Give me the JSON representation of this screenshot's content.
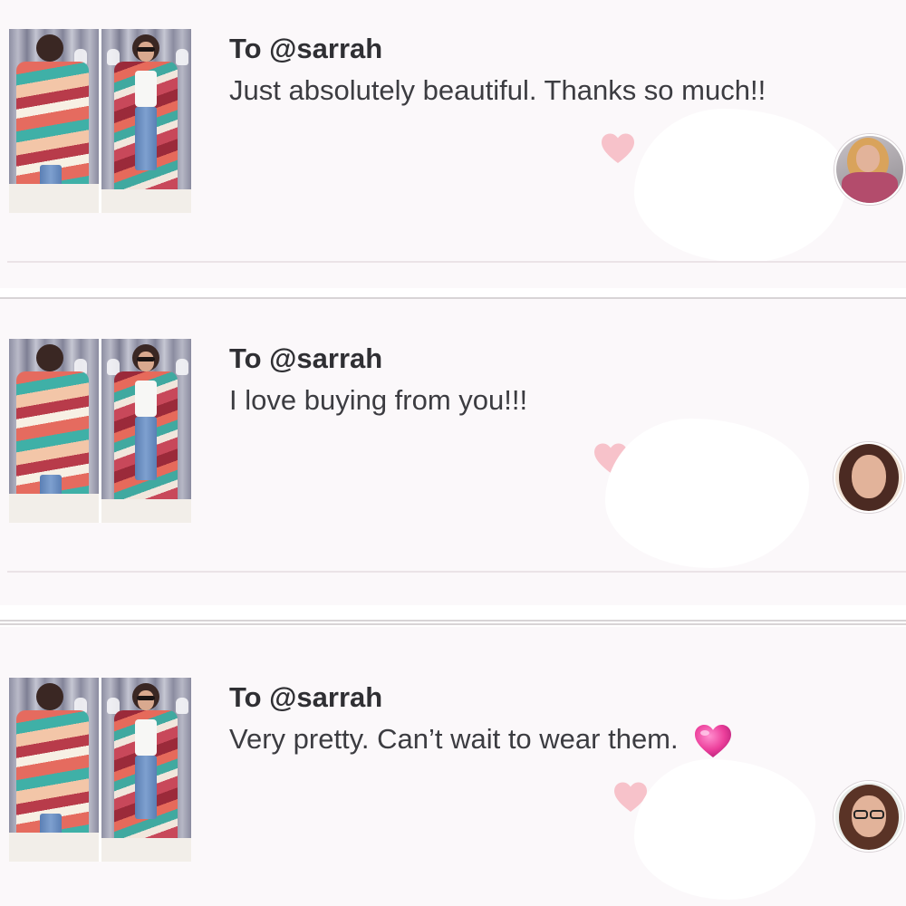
{
  "reviews": [
    {
      "recipient": "To @sarrah",
      "message": "Just absolutely beautiful. Thanks so much!!",
      "emoji": ""
    },
    {
      "recipient": "To @sarrah",
      "message": "I love buying from you!!!",
      "emoji": ""
    },
    {
      "recipient": "To @sarrah",
      "message": "Very pretty. Can’t wait to wear them.",
      "emoji": "sparkling-heart-icon"
    }
  ],
  "icons": {
    "like": "heart-icon",
    "avatar": "reviewer-avatar"
  },
  "colors": {
    "like_heart": "#f7c2ca",
    "emoji_heart": "#ec3f9b",
    "text_primary": "#2f2f33",
    "background": "#fbf8fa"
  }
}
